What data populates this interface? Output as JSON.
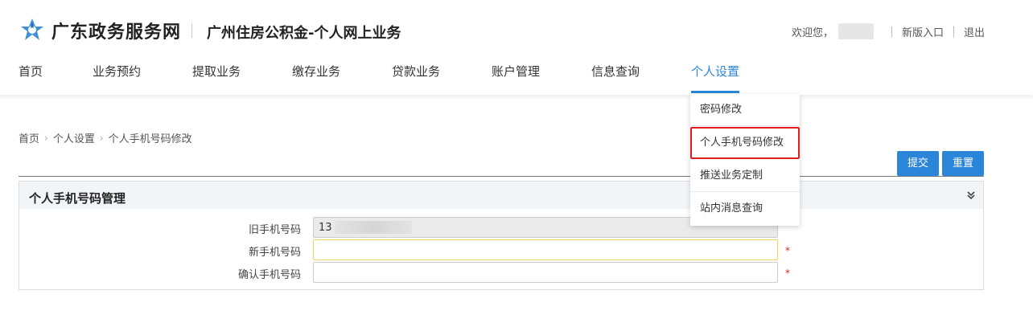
{
  "brand": {
    "name": "广东政务服务网",
    "sub_title": "广州住房公积金-个人网上业务"
  },
  "top_bar": {
    "welcome": "欢迎您，",
    "new_entry": "新版入口",
    "logout": "退出"
  },
  "nav": [
    {
      "label": "首页"
    },
    {
      "label": "业务预约"
    },
    {
      "label": "提取业务"
    },
    {
      "label": "缴存业务"
    },
    {
      "label": "贷款业务"
    },
    {
      "label": "账户管理"
    },
    {
      "label": "信息查询"
    },
    {
      "label": "个人设置",
      "active": true
    }
  ],
  "dropdown": [
    {
      "label": "密码修改"
    },
    {
      "label": "个人手机号码修改",
      "highlighted": true
    },
    {
      "label": "推送业务定制"
    },
    {
      "label": "站内消息查询"
    }
  ],
  "breadcrumb": [
    "首页",
    "个人设置",
    "个人手机号码修改"
  ],
  "actions": {
    "submit": "提交",
    "reset": "重置"
  },
  "panel": {
    "title": "个人手机号码管理",
    "fields": [
      {
        "label": "旧手机号码",
        "value": "13",
        "readonly": true
      },
      {
        "label": "新手机号码",
        "value": "",
        "required": true
      },
      {
        "label": "确认手机号码",
        "value": "",
        "required": true
      }
    ],
    "required_mark": "*"
  },
  "colors": {
    "accent": "#2b86d9",
    "highlight_border": "#e02020",
    "required": "#e02020"
  }
}
